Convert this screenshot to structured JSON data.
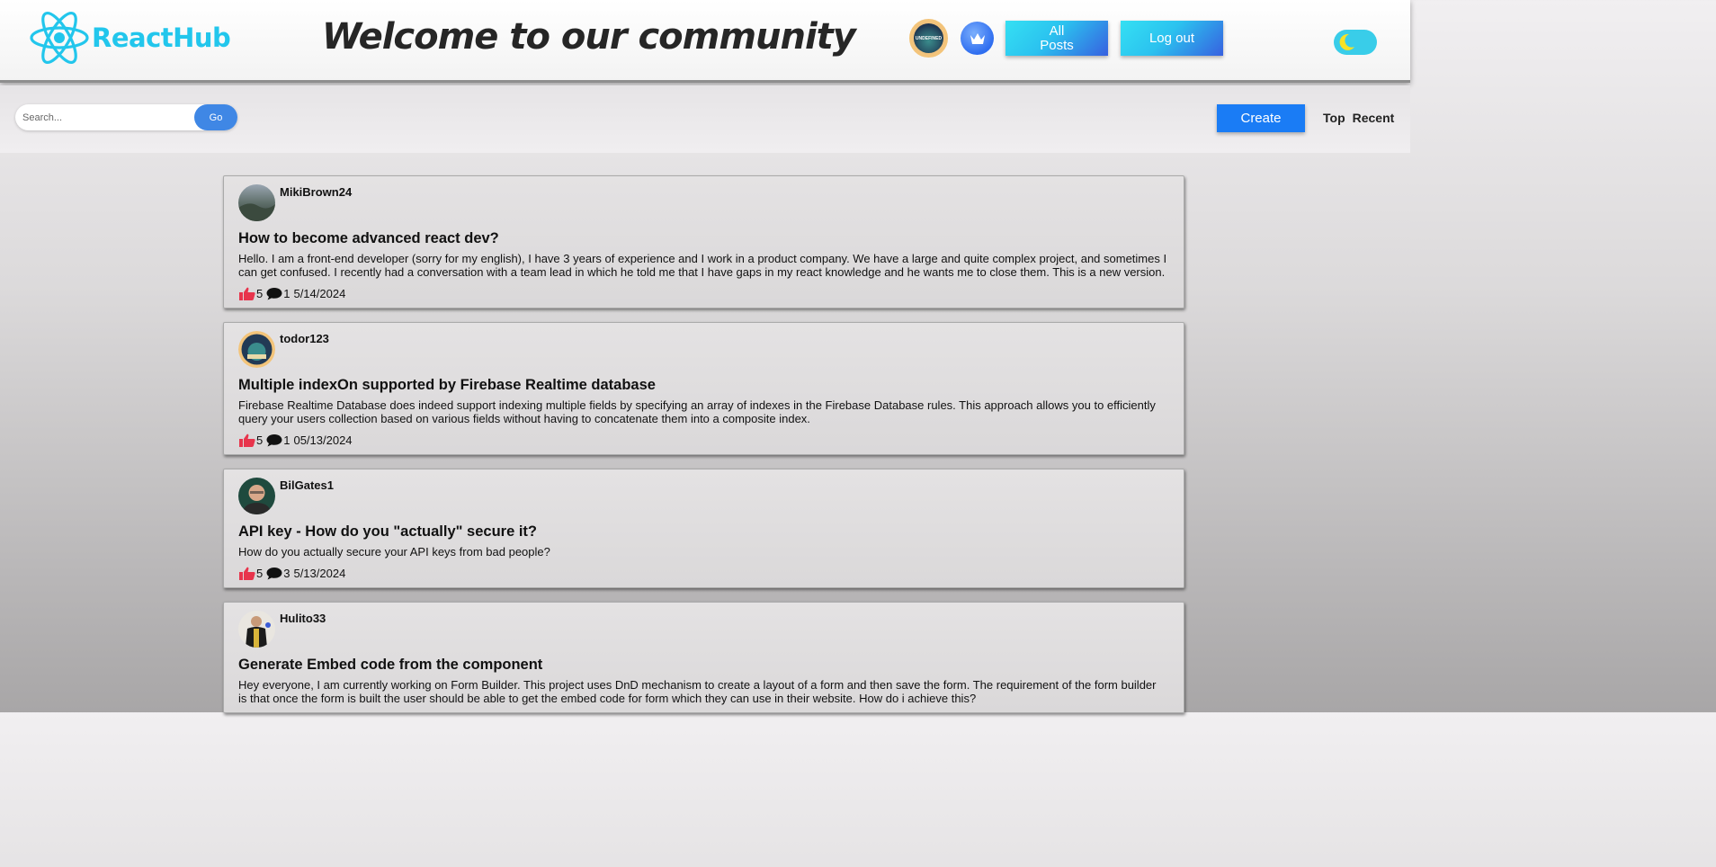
{
  "header": {
    "logo_text": "ReactHub",
    "welcome": "Welcome to our community",
    "avatar_badge_text": "UNDEFINED",
    "all_posts_line1": "All",
    "all_posts_line2": "Posts",
    "logout": "Log out"
  },
  "toolbar": {
    "search_placeholder": "Search...",
    "go": "Go",
    "create": "Create",
    "sort_top": "Top",
    "sort_recent": "Recent"
  },
  "posts": [
    {
      "author": "MikiBrown24",
      "title": "How to become advanced react dev?",
      "body": "Hello. I am a front-end developer (sorry for my english), I have 3 years of experience and I work in a product company. We have a large and quite complex project, and sometimes I can get confused. I recently had a conversation with a team lead in which he told me that I have gaps in my react knowledge and he wants me to close them. This is a new version.",
      "likes": "5",
      "comments": "1",
      "date": "5/14/2024"
    },
    {
      "author": "todor123",
      "title": "Multiple indexOn supported by Firebase Realtime database",
      "body": "Firebase Realtime Database does indeed support indexing multiple fields by specifying an array of indexes in the Firebase Database rules. This approach allows you to efficiently query your users collection based on various fields without having to concatenate them into a composite index.",
      "likes": "5",
      "comments": "1",
      "date": "05/13/2024"
    },
    {
      "author": "BilGates1",
      "title": "API key - How do you \"actually\" secure it?",
      "body": "How do you actually secure your API keys from bad people?",
      "likes": "5",
      "comments": "3",
      "date": "5/13/2024"
    },
    {
      "author": "Hulito33",
      "title": "Generate Embed code from the component",
      "body": "Hey everyone, I am currently working on Form Builder. This project uses DnD mechanism to create a layout of a form and then save the form. The requirement of the form builder is that once the form is built the user should be able to get the embed code for form which they can use in their website. How do i achieve this?",
      "likes": "",
      "comments": "",
      "date": ""
    }
  ],
  "colors": {
    "brand": "#22c6ec",
    "like": "#e8344c",
    "create": "#1a7cf5",
    "go": "#3f87e5",
    "toggle": "#39cde9",
    "moon": "#f7e225"
  },
  "icons": {
    "logo": "react-atom-icon",
    "crown": "crown-icon",
    "theme": "moon-icon",
    "like": "thumbs-up-icon",
    "comment": "speech-bubble-icon"
  }
}
